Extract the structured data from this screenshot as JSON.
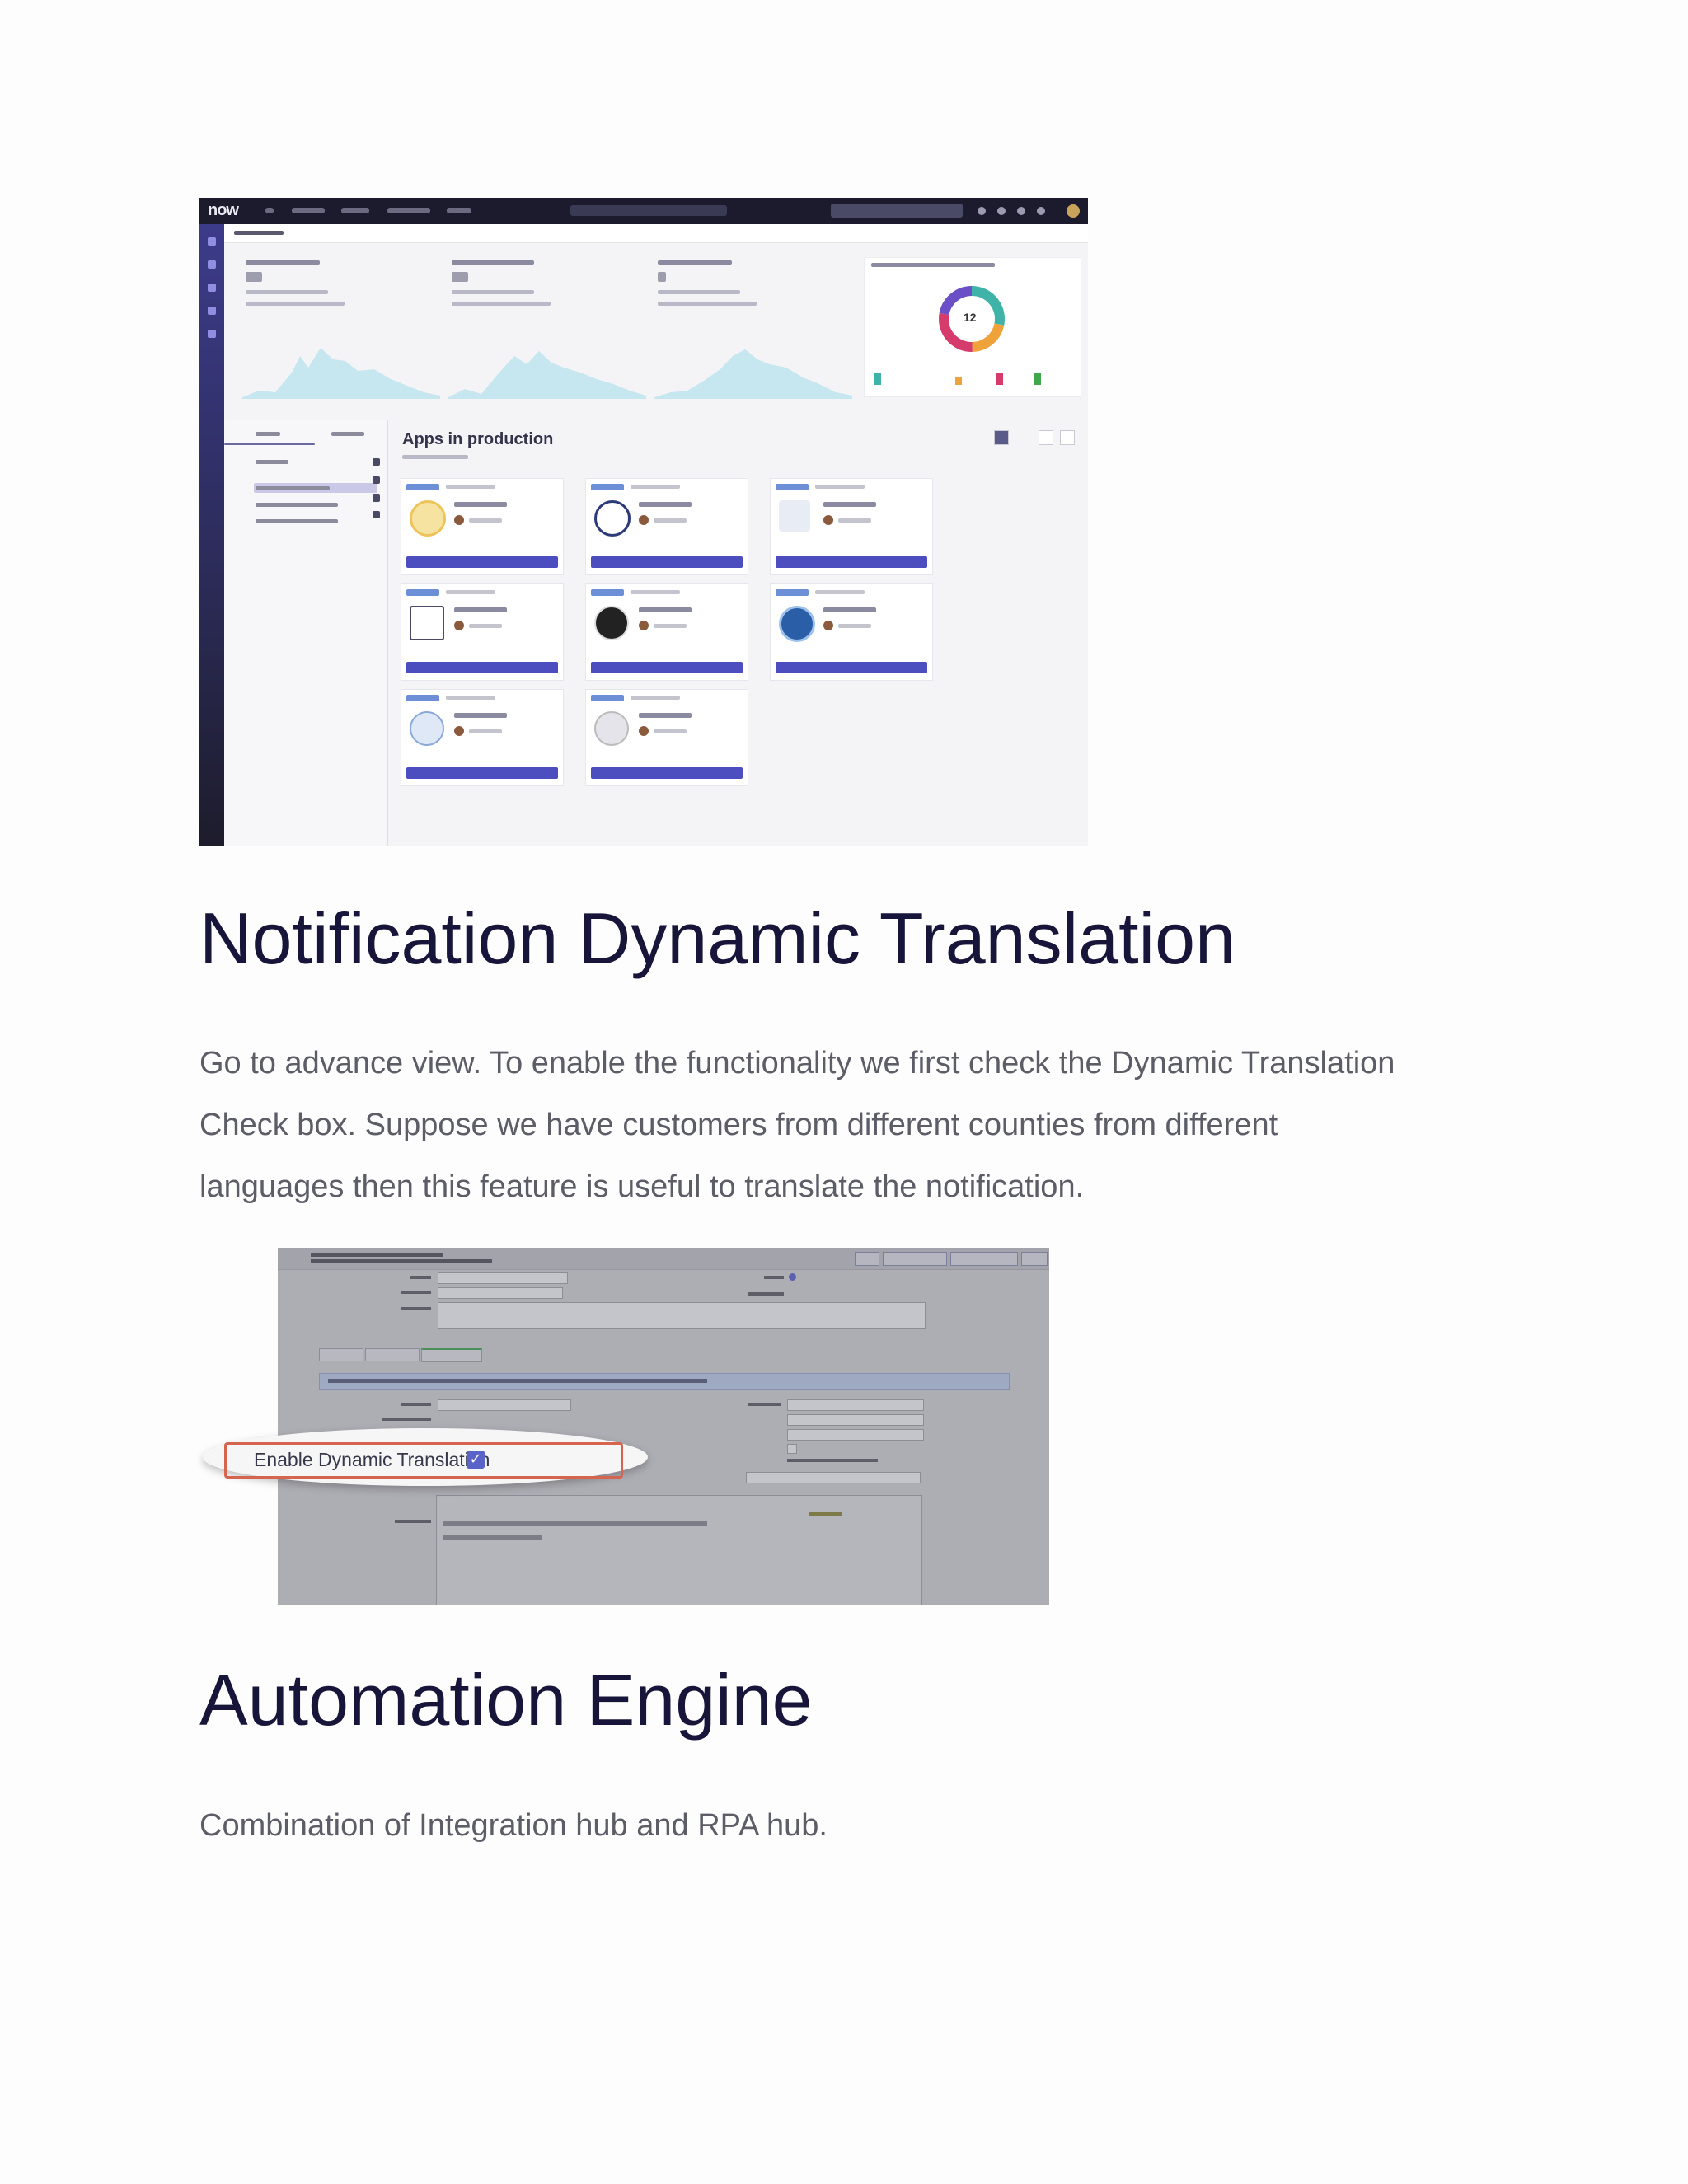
{
  "screenshot1": {
    "logo": "now",
    "apps_title": "Apps in production",
    "donut_center": "12"
  },
  "section1": {
    "heading": "Notification Dynamic Translation",
    "paragraph_lines": [
      "Go to advance view. To enable the functionality we first check the Dynamic Translation",
      "Check box. Suppose we have customers from different counties from different",
      "languages then this feature is useful to translate the notification."
    ]
  },
  "screenshot2": {
    "callout_label": "Enable Dynamic Translation",
    "callout_check": "✓"
  },
  "section2": {
    "heading": "Automation Engine",
    "paragraph": "Combination of Integration hub and RPA hub."
  }
}
